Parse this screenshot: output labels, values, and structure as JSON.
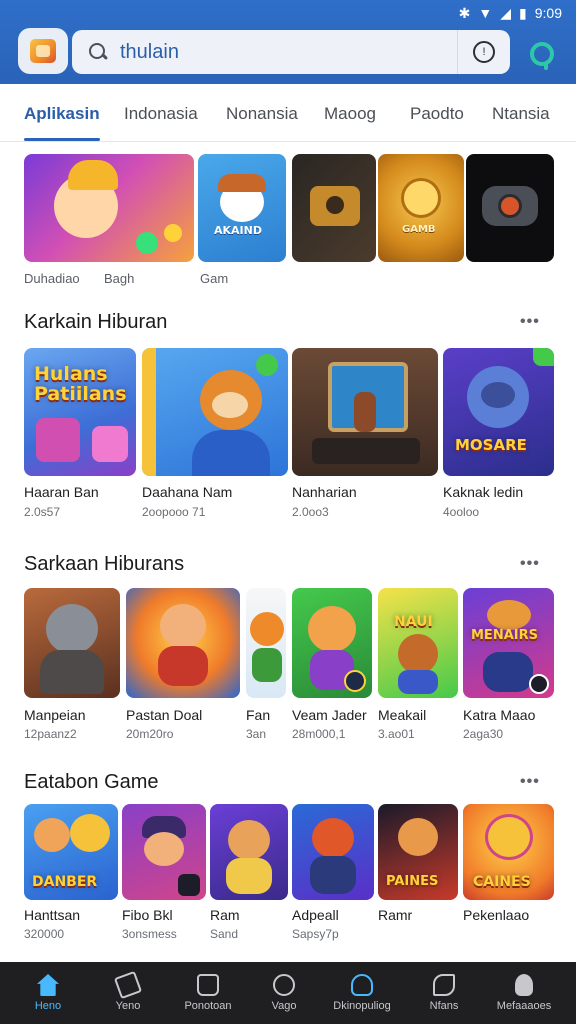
{
  "status_bar": {
    "time": "9:09"
  },
  "search": {
    "query": "thulain"
  },
  "tabs": [
    {
      "label": "Aplikasin",
      "active": true
    },
    {
      "label": "Indonasia"
    },
    {
      "label": "Nonansia"
    },
    {
      "label": "Maoog"
    },
    {
      "label": "Paodto"
    },
    {
      "label": "Ntansia"
    }
  ],
  "banners": [
    {
      "label": "Duhadiao"
    },
    {
      "label": "Bagh"
    },
    {
      "label": "Gam"
    },
    {
      "label": ""
    },
    {
      "label": ""
    },
    {
      "label": ""
    }
  ],
  "banner_texts": {
    "b2": "AKAIND",
    "b4": "GAMB"
  },
  "section1": {
    "title": "Karkain Hiburan",
    "more": "•••",
    "cards": [
      {
        "title": "Haaran Ban",
        "sub": "2.0s57",
        "art": "Hulans Patiilans"
      },
      {
        "title": "Daahana Nam",
        "sub": "2oopooo 71",
        "art": ""
      },
      {
        "title": "Nanharian",
        "sub": "2.0oo3",
        "art": ""
      },
      {
        "title": "Kaknak ledin",
        "sub": "4ooloo",
        "art": "MOSARE"
      }
    ]
  },
  "section2": {
    "title": "Sarkaan Hiburans",
    "more": "•••",
    "cards": [
      {
        "title": "Manpeian",
        "sub": "12paanz2",
        "art": ""
      },
      {
        "title": "Pastan Doal",
        "sub": "20m20ro",
        "art": ""
      },
      {
        "title": "Fan",
        "sub": "3an",
        "art": ""
      },
      {
        "title": "Veam Jader",
        "sub": "28m000,1",
        "art": ""
      },
      {
        "title": "Meakail",
        "sub": "3.ao01",
        "art": "NAUI"
      },
      {
        "title": "Katra Maao",
        "sub": "2aga30",
        "art": "MENAIRS"
      }
    ]
  },
  "section3": {
    "title": "Eatabon Game",
    "more": "•••",
    "cards": [
      {
        "title": "Hanttsan",
        "sub": "320000",
        "art": "DANBER"
      },
      {
        "title": "Fibo Bkl",
        "sub": "3onsmess",
        "art": ""
      },
      {
        "title": "Ram",
        "sub": "Sand",
        "art": ""
      },
      {
        "title": "Adpeall",
        "sub": "Sapsy7p",
        "art": ""
      },
      {
        "title": "Ramr",
        "sub": "",
        "art": "PAINES"
      },
      {
        "title": "Pekenlaao",
        "sub": "",
        "art": "CAINES"
      }
    ]
  },
  "bottom_nav": [
    {
      "label": "Heno",
      "icon": "home-icon",
      "active": true
    },
    {
      "label": "Yeno",
      "icon": "edit-icon"
    },
    {
      "label": "Ponotoan",
      "icon": "bag-icon"
    },
    {
      "label": "Vago",
      "icon": "circle-icon"
    },
    {
      "label": "Dkinopuliog",
      "icon": "connect-icon"
    },
    {
      "label": "Nfans",
      "icon": "leaf-icon"
    },
    {
      "label": "Mefaaaoes",
      "icon": "person-icon"
    }
  ],
  "colors": {
    "header": "#2f6fc9",
    "accent": "#2a63b8",
    "nav_bg": "#1f1f21",
    "nav_active": "#49b9ff"
  }
}
